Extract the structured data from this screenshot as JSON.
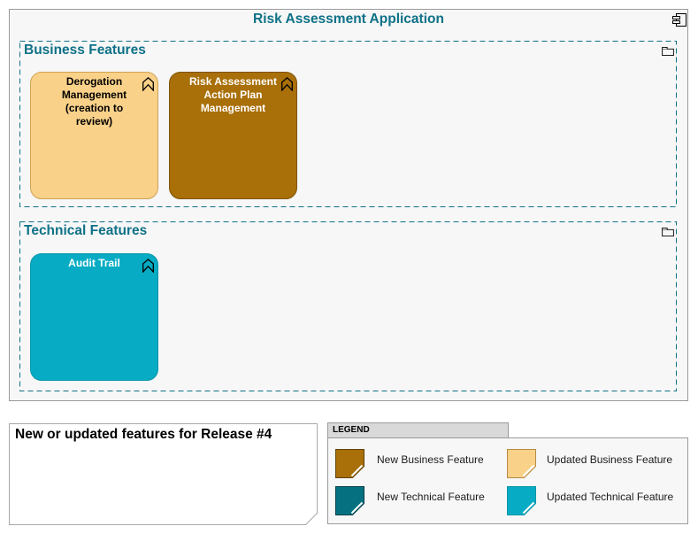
{
  "application": {
    "title": "Risk Assessment Application",
    "icon": "component-icon",
    "fill": "#F7F7F7",
    "border": "#9A9A9A",
    "title_color": "#0E7187"
  },
  "groups": [
    {
      "label": "Business Features",
      "icon": "folder-icon",
      "border_color": "#0E7187",
      "features": [
        {
          "label": "Derogation Management (creation to review)",
          "icon": "bookmark-icon",
          "fill": "#FAD189",
          "border": "#CFA156",
          "text_color": "#000000"
        },
        {
          "label": "Risk Assessment Action Plan Management",
          "icon": "bookmark-icon",
          "fill": "#A96F08",
          "border": "#7E5306",
          "text_color": "#FFFFFF"
        }
      ]
    },
    {
      "label": "Technical Features",
      "icon": "folder-icon",
      "border_color": "#0E7187",
      "features": [
        {
          "label": "Audit Trail",
          "icon": "bookmark-icon",
          "fill": "#07ACC4",
          "border": "#0894AA",
          "text_color": "#FFFFFF"
        }
      ]
    }
  ],
  "note": {
    "text": "New or updated features for Release #4",
    "fill": "#FFFFFF",
    "border": "#A8A8A8"
  },
  "legend": {
    "title": "LEGEND",
    "header_fill": "#D9D9D9",
    "body_fill": "#F7F7F7",
    "items": [
      {
        "label": "New Business Feature",
        "color": "#A96F08",
        "border": "#5E4206"
      },
      {
        "label": "Updated Business Feature",
        "color": "#FAD189",
        "border": "#B68B44"
      },
      {
        "label": "New Technical Feature",
        "color": "#057180",
        "border": "#043E48"
      },
      {
        "label": "Updated Technical Feature",
        "color": "#07ACC4",
        "border": "#0794A8"
      }
    ]
  }
}
